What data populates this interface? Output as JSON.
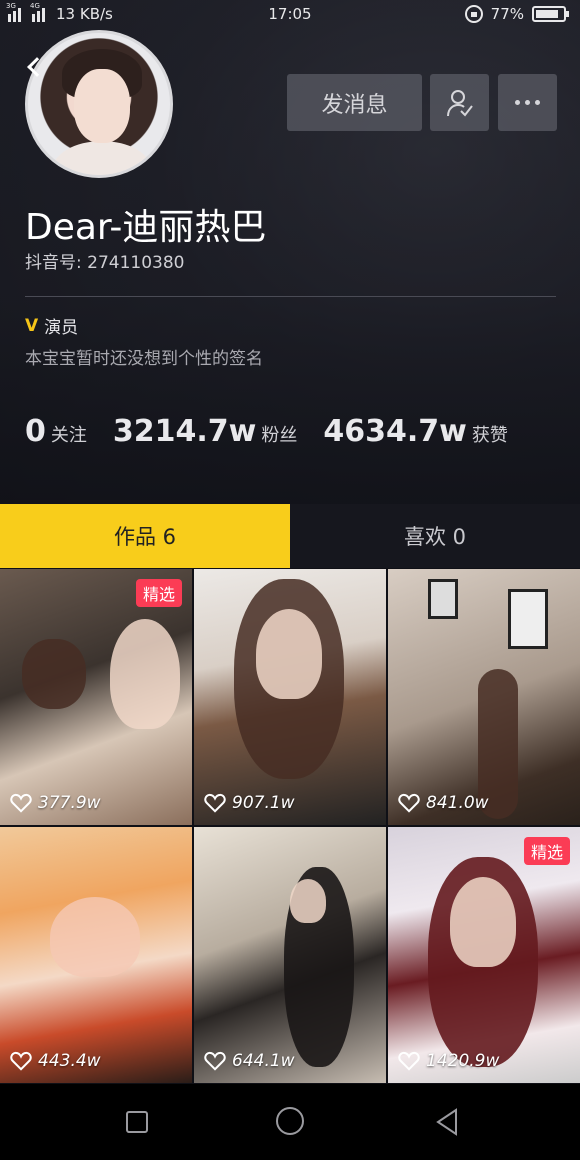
{
  "status_bar": {
    "network_1": "3G",
    "network_2": "4G",
    "speed": "13 KB/s",
    "time": "17:05",
    "battery": "77%"
  },
  "profile": {
    "name": "Dear-迪丽热巴",
    "douyin_id": "抖音号: 274110380",
    "verify_badge": "V",
    "role": "演员",
    "bio": "本宝宝暂时还没想到个性的签名"
  },
  "actions": {
    "message_label": "发消息",
    "follow_icon": "user-check-icon",
    "more_icon": "more-dots-icon"
  },
  "stats": {
    "following_num": "0",
    "following_label": "关注",
    "fans_num": "3214.7w",
    "fans_label": "粉丝",
    "likes_num": "4634.7w",
    "likes_label": "获赞"
  },
  "tabs": [
    {
      "label": "作品 6",
      "active": true
    },
    {
      "label": "喜欢 0",
      "active": false
    }
  ],
  "videos": [
    {
      "likes": "377.9w",
      "badge": "精选"
    },
    {
      "likes": "907.1w",
      "badge": ""
    },
    {
      "likes": "841.0w",
      "badge": ""
    },
    {
      "likes": "443.4w",
      "badge": ""
    },
    {
      "likes": "644.1w",
      "badge": ""
    },
    {
      "likes": "1420.9w",
      "badge": "精选"
    }
  ],
  "colors": {
    "accent_yellow": "#f8cd1b",
    "badge_red": "#fb3c55",
    "verify_gold": "#f5c518"
  },
  "nav_icons": [
    "recent-apps-icon",
    "home-icon",
    "back-icon"
  ]
}
